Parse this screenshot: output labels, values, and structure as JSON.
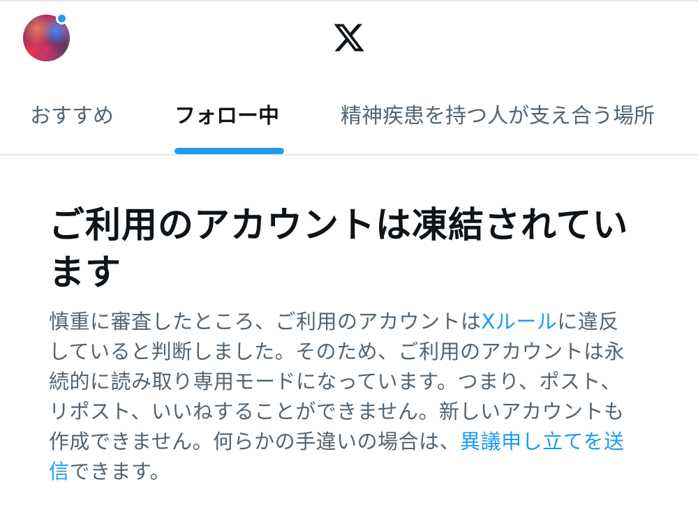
{
  "header": {
    "avatar_icon": "user-avatar",
    "notification_dot_color": "#1d9bf0",
    "logo_icon": "x-logo-icon"
  },
  "tabs": [
    {
      "label": "おすすめ",
      "active": false
    },
    {
      "label": "フォロー中",
      "active": true
    },
    {
      "label": "精神疾患を持つ人が支え合う場所",
      "active": false
    }
  ],
  "accent_color": "#1d9bf0",
  "notice": {
    "title": "ご利用のアカウントは凍結されています",
    "body_1": "慎重に審査したところ、ご利用のアカウントは",
    "rules_link": "Xルール",
    "body_2": "に違反していると判断しました。そのため、ご利用のアカウントは永続的に読み取り専用モードになっています。つまり、ポスト、リポスト、いいねすることができません。新しいアカウントも作成できません。何らかの手違いの場合は、",
    "appeal_link": "異議申し立てを送信",
    "body_3": "できます。"
  }
}
